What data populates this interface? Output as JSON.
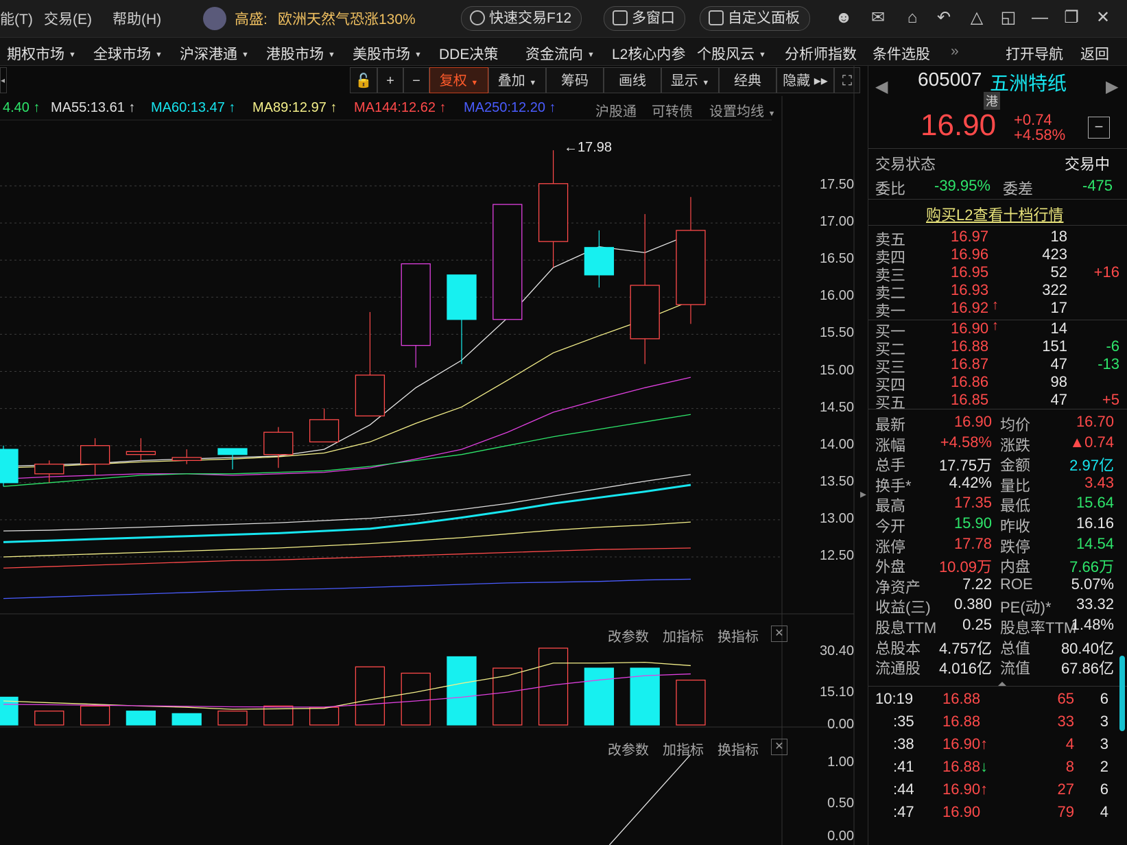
{
  "titlebar": {
    "menus": [
      "能(T)",
      "交易(E)",
      "帮助(H)"
    ],
    "news_source": "高盛:",
    "news_text": "欧洲天然气恐涨130%",
    "quick_trade": "快速交易F12",
    "multi_window": "多窗口",
    "custom_panel": "自定义面板"
  },
  "navbar": {
    "items": [
      "期权市场",
      "全球市场",
      "沪深港通",
      "港股市场",
      "美股市场",
      "DDE决策",
      "资金流向",
      "L2核心内参",
      "个股风云",
      "分析师指数",
      "条件选股"
    ],
    "more": "»",
    "open_nav": "打开导航",
    "back": "返回"
  },
  "toolbar": {
    "fuquan": "复权",
    "diejia": "叠加",
    "chouma": "筹码",
    "huaxian": "画线",
    "xianshi": "显示",
    "jingdian": "经典",
    "yincang": "隐藏"
  },
  "ma_legend": [
    {
      "text": "4.40",
      "color": "#2ee66b"
    },
    {
      "text": "MA55:13.61",
      "color": "#e0e0e0"
    },
    {
      "text": "MA60:13.47",
      "color": "#17e6f0"
    },
    {
      "text": "MA89:12.97",
      "color": "#f5f08a"
    },
    {
      "text": "MA144:12.62",
      "color": "#ff4a4a"
    },
    {
      "text": "MA250:12.20",
      "color": "#4a5cff"
    }
  ],
  "chart_options": [
    "沪股通",
    "可转债",
    "设置均线"
  ],
  "chart_data": {
    "type": "candlestick",
    "price_axis": [
      "17.50",
      "17.00",
      "16.50",
      "16.00",
      "15.50",
      "15.00",
      "14.50",
      "14.00",
      "13.50",
      "13.00",
      "12.50"
    ],
    "high_marker": "17.98",
    "candles": [
      {
        "open": 13.5,
        "close": 13.95,
        "high": 14.0,
        "low": 13.45,
        "color": "cyan"
      },
      {
        "open": 13.62,
        "close": 13.75,
        "high": 13.8,
        "low": 13.5,
        "color": "red"
      },
      {
        "open": 13.75,
        "close": 14.0,
        "high": 14.1,
        "low": 13.6,
        "color": "red"
      },
      {
        "open": 13.88,
        "close": 13.92,
        "high": 14.1,
        "low": 13.8,
        "color": "red"
      },
      {
        "open": 13.8,
        "close": 13.84,
        "high": 13.95,
        "low": 13.75,
        "color": "red"
      },
      {
        "open": 13.96,
        "close": 13.88,
        "high": 13.95,
        "low": 13.68,
        "color": "cyan"
      },
      {
        "open": 13.88,
        "close": 14.18,
        "high": 14.25,
        "low": 13.7,
        "color": "red"
      },
      {
        "open": 14.05,
        "close": 14.35,
        "high": 14.5,
        "low": 14.05,
        "color": "red"
      },
      {
        "open": 14.4,
        "close": 14.95,
        "high": 15.8,
        "low": 14.4,
        "color": "red"
      },
      {
        "open": 15.35,
        "close": 16.45,
        "high": 16.45,
        "low": 15.05,
        "color": "magenta"
      },
      {
        "open": 16.3,
        "close": 15.7,
        "high": 16.3,
        "low": 15.1,
        "color": "cyan"
      },
      {
        "open": 15.7,
        "close": 17.25,
        "high": 17.25,
        "low": 15.7,
        "color": "magenta"
      },
      {
        "open": 16.75,
        "close": 17.53,
        "high": 17.98,
        "low": 16.4,
        "color": "red"
      },
      {
        "open": 16.67,
        "close": 16.3,
        "high": 16.9,
        "low": 16.13,
        "color": "cyan"
      },
      {
        "open": 15.44,
        "close": 16.16,
        "high": 17.12,
        "low": 15.1,
        "color": "red"
      },
      {
        "open": 15.9,
        "close": 16.9,
        "high": 17.35,
        "low": 15.64,
        "color": "red"
      }
    ],
    "ma_lines": [
      {
        "name": "MA5",
        "color": "#e8e8e8",
        "values": [
          13.72,
          13.74,
          13.76,
          13.8,
          13.82,
          13.84,
          13.86,
          13.95,
          14.28,
          14.78,
          15.15,
          15.72,
          16.4,
          16.68,
          16.6,
          16.85
        ]
      },
      {
        "name": "MA10",
        "color": "#f5f08a",
        "values": [
          13.7,
          13.72,
          13.75,
          13.78,
          13.8,
          13.82,
          13.85,
          13.9,
          14.05,
          14.3,
          14.52,
          14.88,
          15.25,
          15.48,
          15.7,
          15.95
        ]
      },
      {
        "name": "MA20",
        "color": "#e040e0",
        "values": [
          13.55,
          13.58,
          13.6,
          13.62,
          13.62,
          13.6,
          13.62,
          13.64,
          13.7,
          13.82,
          13.95,
          14.18,
          14.45,
          14.62,
          14.78,
          14.92
        ]
      },
      {
        "name": "MA30",
        "color": "#2ee66b",
        "values": [
          13.45,
          13.5,
          13.55,
          13.6,
          13.62,
          13.62,
          13.64,
          13.66,
          13.72,
          13.8,
          13.88,
          14.0,
          14.12,
          14.22,
          14.32,
          14.42
        ]
      },
      {
        "name": "MA55",
        "color": "#e0e0e0",
        "values": [
          12.85,
          12.86,
          12.88,
          12.9,
          12.92,
          12.94,
          12.96,
          12.99,
          13.02,
          13.07,
          13.14,
          13.22,
          13.32,
          13.42,
          13.52,
          13.61
        ]
      },
      {
        "name": "MA60",
        "color": "#17e6f0",
        "values": [
          12.7,
          12.72,
          12.74,
          12.76,
          12.78,
          12.8,
          12.82,
          12.85,
          12.88,
          12.95,
          13.03,
          13.12,
          13.22,
          13.3,
          13.38,
          13.47
        ]
      },
      {
        "name": "MA89",
        "color": "#f5f08a",
        "values": [
          12.5,
          12.52,
          12.54,
          12.56,
          12.58,
          12.6,
          12.62,
          12.65,
          12.68,
          12.72,
          12.76,
          12.81,
          12.86,
          12.9,
          12.93,
          12.97
        ]
      },
      {
        "name": "MA144",
        "color": "#ff4a4a",
        "values": [
          12.35,
          12.37,
          12.39,
          12.41,
          12.43,
          12.45,
          12.46,
          12.48,
          12.5,
          12.52,
          12.54,
          12.56,
          12.58,
          12.6,
          12.61,
          12.62
        ]
      },
      {
        "name": "MA250",
        "color": "#4a5cff",
        "values": [
          11.94,
          11.96,
          11.98,
          12.0,
          12.02,
          12.04,
          12.06,
          12.07,
          12.09,
          12.11,
          12.13,
          12.15,
          12.16,
          12.17,
          12.19,
          12.2
        ]
      }
    ],
    "volume_axis": [
      "30.40",
      "15.10",
      "0.00"
    ],
    "volume": [
      {
        "value": 11.0,
        "color": "cyan"
      },
      {
        "value": 5.5,
        "color": "red"
      },
      {
        "value": 7.5,
        "color": "red"
      },
      {
        "value": 5.5,
        "color": "cyan"
      },
      {
        "value": 4.5,
        "color": "cyan"
      },
      {
        "value": 5.5,
        "color": "red"
      },
      {
        "value": 7.5,
        "color": "red"
      },
      {
        "value": 7.0,
        "color": "red"
      },
      {
        "value": 23.0,
        "color": "red"
      },
      {
        "value": 20.5,
        "color": "red"
      },
      {
        "value": 27.0,
        "color": "cyan"
      },
      {
        "value": 22.5,
        "color": "red"
      },
      {
        "value": 30.4,
        "color": "red"
      },
      {
        "value": 22.5,
        "color": "cyan"
      },
      {
        "value": 22.5,
        "color": "cyan"
      },
      {
        "value": 17.75,
        "color": "red"
      }
    ],
    "volume_ma": [
      {
        "color": "#f5f08a",
        "values": [
          9.5,
          8.8,
          8.2,
          7.5,
          7.0,
          6.2,
          6.4,
          6.6,
          10.0,
          13.0,
          16.5,
          19.5,
          24.5,
          24.5,
          24.8,
          23.5
        ]
      },
      {
        "color": "#e040e0",
        "values": [
          8.2,
          8.0,
          7.8,
          7.6,
          7.4,
          7.2,
          7.1,
          7.1,
          8.2,
          9.5,
          11.0,
          13.0,
          15.8,
          17.8,
          19.5,
          20.2
        ]
      }
    ],
    "indicator_axis": [
      "1.00",
      "0.50",
      "0.00"
    ]
  },
  "sub_options": [
    "改参数",
    "加指标",
    "换指标"
  ],
  "quote": {
    "code": "605007",
    "name": "五洲特纸",
    "tag": "港",
    "price": "16.90",
    "change": "+0.74",
    "change_pct": "+4.58%",
    "status_label": "交易状态",
    "status_value": "交易中",
    "weibi_label": "委比",
    "weibi_value": "-39.95%",
    "weicha_label": "委差",
    "weicha_value": "-475",
    "l2_link": "购买L2查看十档行情"
  },
  "sell_orders": [
    {
      "label": "卖五",
      "price": "16.97",
      "vol": "18",
      "chg": ""
    },
    {
      "label": "卖四",
      "price": "16.96",
      "vol": "423",
      "chg": ""
    },
    {
      "label": "卖三",
      "price": "16.95",
      "vol": "52",
      "chg": "+16"
    },
    {
      "label": "卖二",
      "price": "16.93",
      "vol": "322",
      "chg": ""
    },
    {
      "label": "卖一",
      "price": "16.92",
      "vol": "17",
      "chg": "",
      "arrow": "up"
    }
  ],
  "buy_orders": [
    {
      "label": "买一",
      "price": "16.90",
      "vol": "14",
      "chg": "",
      "arrow": "up"
    },
    {
      "label": "买二",
      "price": "16.88",
      "vol": "151",
      "chg": "-6"
    },
    {
      "label": "买三",
      "price": "16.87",
      "vol": "47",
      "chg": "-13"
    },
    {
      "label": "买四",
      "price": "16.86",
      "vol": "98",
      "chg": ""
    },
    {
      "label": "买五",
      "price": "16.85",
      "vol": "47",
      "chg": "+5"
    }
  ],
  "stats": [
    {
      "l1": "最新",
      "v1": "16.90",
      "c1": "red",
      "l2": "均价",
      "v2": "16.70",
      "c2": "red"
    },
    {
      "l1": "涨幅",
      "v1": "+4.58%",
      "c1": "red",
      "l2": "涨跌",
      "v2": "▲0.74",
      "c2": "red"
    },
    {
      "l1": "总手",
      "v1": "17.75万",
      "c1": "white",
      "l2": "金额",
      "v2": "2.97亿",
      "c2": "cyan"
    },
    {
      "l1": "换手*",
      "v1": "4.42%",
      "c1": "white",
      "l2": "量比",
      "v2": "3.43",
      "c2": "red"
    },
    {
      "l1": "最高",
      "v1": "17.35",
      "c1": "red",
      "l2": "最低",
      "v2": "15.64",
      "c2": "green"
    },
    {
      "l1": "今开",
      "v1": "15.90",
      "c1": "green",
      "l2": "昨收",
      "v2": "16.16",
      "c2": "white"
    },
    {
      "l1": "涨停",
      "v1": "17.78",
      "c1": "red",
      "l2": "跌停",
      "v2": "14.54",
      "c2": "green"
    },
    {
      "l1": "外盘",
      "v1": "10.09万",
      "c1": "red",
      "l2": "内盘",
      "v2": "7.66万",
      "c2": "green"
    },
    {
      "l1": "净资产",
      "v1": "7.22",
      "c1": "white",
      "l2": "ROE",
      "v2": "5.07%",
      "c2": "white"
    },
    {
      "l1": "收益(三)",
      "v1": "0.380",
      "c1": "white",
      "l2": "PE(动)*",
      "v2": "33.32",
      "c2": "white"
    },
    {
      "l1": "股息TTM",
      "v1": "0.25",
      "c1": "white",
      "l2": "股息率TTM",
      "v2": "1.48%",
      "c2": "white"
    },
    {
      "l1": "总股本",
      "v1": "4.757亿",
      "c1": "white",
      "l2": "总值",
      "v2": "80.40亿",
      "c2": "white"
    },
    {
      "l1": "流通股",
      "v1": "4.016亿",
      "c1": "white",
      "l2": "流值",
      "v2": "67.86亿",
      "c2": "white"
    }
  ],
  "ticks": [
    {
      "time": "10:19",
      "price": "16.88",
      "vol": "65",
      "n": "6",
      "arrow": ""
    },
    {
      "time": ":35",
      "price": "16.88",
      "vol": "33",
      "n": "3",
      "arrow": ""
    },
    {
      "time": ":38",
      "price": "16.90",
      "vol": "4",
      "n": "3",
      "arrow": "up"
    },
    {
      "time": ":41",
      "price": "16.88",
      "vol": "8",
      "n": "2",
      "arrow": "down"
    },
    {
      "time": ":44",
      "price": "16.90",
      "vol": "27",
      "n": "6",
      "arrow": "up"
    },
    {
      "time": ":47",
      "price": "16.90",
      "vol": "79",
      "n": "4",
      "arrow": ""
    }
  ]
}
